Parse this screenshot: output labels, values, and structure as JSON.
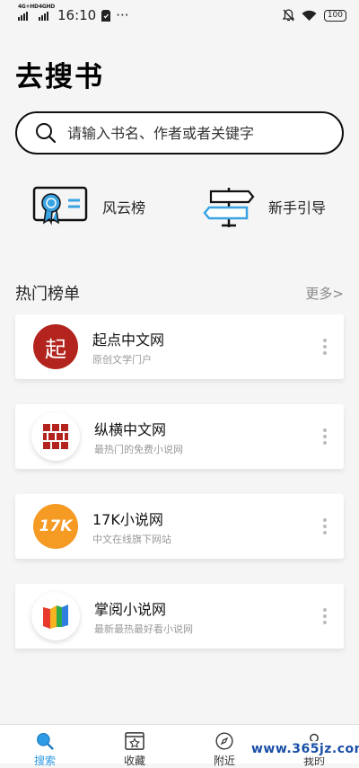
{
  "status_bar": {
    "network_1": "4G+HD",
    "network_2": "4GHD",
    "time": "16:10",
    "more": "···",
    "battery": "100"
  },
  "page": {
    "title": "去搜书"
  },
  "search": {
    "placeholder": "请输入书名、作者或者关键字"
  },
  "quick_links": [
    {
      "label": "风云榜",
      "icon": "certificate-icon"
    },
    {
      "label": "新手引导",
      "icon": "signpost-icon"
    }
  ],
  "section": {
    "title": "热门榜单",
    "more": "更多>"
  },
  "rankings": [
    {
      "name": "起点中文网",
      "desc": "原创文学门户",
      "logo_color": "#b3241e",
      "logo_text": "起"
    },
    {
      "name": "纵横中文网",
      "desc": "最热门的免费小说网",
      "logo_color": "#b3241e",
      "logo_text": ""
    },
    {
      "name": "17K小说网",
      "desc": "中文在线旗下网站",
      "logo_color": "#f59a23",
      "logo_text": "17K"
    },
    {
      "name": "掌阅小说网",
      "desc": "最新最热最好看小说网",
      "logo_color": "#e8392d",
      "logo_text": ""
    }
  ],
  "tabbar": {
    "items": [
      {
        "label": "搜索",
        "icon": "search-icon",
        "active": true
      },
      {
        "label": "收藏",
        "icon": "bookmark-star-icon",
        "active": false
      },
      {
        "label": "附近",
        "icon": "compass-icon",
        "active": false
      },
      {
        "label": "我的",
        "icon": "user-icon",
        "active": false
      }
    ]
  },
  "watermark": "www.365jz.com",
  "colors": {
    "accent": "#2e9be6",
    "background": "#f5f5f5"
  }
}
